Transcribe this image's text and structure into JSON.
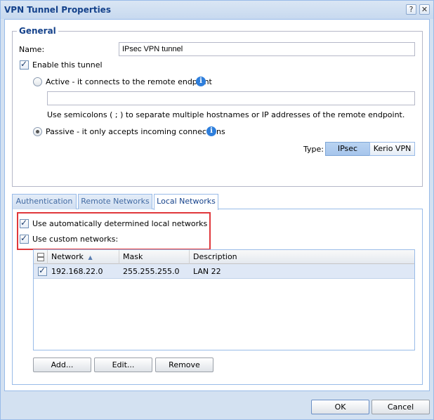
{
  "window": {
    "title": "VPN Tunnel Properties",
    "help_glyph": "?",
    "close_glyph": "✕"
  },
  "general": {
    "legend": "General",
    "name_label": "Name:",
    "name_value": "IPsec VPN tunnel",
    "enable_label": "Enable this tunnel",
    "enable_checked": true,
    "active_label": "Active - it connects to the remote endpoint",
    "active_selected": false,
    "endpoint_value": "",
    "endpoint_hint": "Use semicolons ( ; ) to separate multiple hostnames or IP addresses of the remote endpoint.",
    "passive_label": "Passive - it only accepts incoming connections",
    "passive_selected": true,
    "info_glyph": "i",
    "type_label": "Type:",
    "type_options": [
      "IPsec",
      "Kerio VPN"
    ],
    "type_selected": "IPsec"
  },
  "tabs": [
    {
      "label": "Authentication",
      "active": false
    },
    {
      "label": "Remote Networks",
      "active": false
    },
    {
      "label": "Local Networks",
      "active": true
    }
  ],
  "local_networks": {
    "auto_label": "Use automatically determined local networks",
    "auto_checked": true,
    "custom_label": "Use custom networks:",
    "custom_checked": true,
    "columns": [
      "Network",
      "Mask",
      "Description"
    ],
    "sort_glyph": "▲",
    "rows": [
      {
        "checked": true,
        "network": "192.168.22.0",
        "mask": "255.255.255.0",
        "description": "LAN 22"
      }
    ],
    "buttons": {
      "add": "Add...",
      "edit": "Edit...",
      "remove": "Remove"
    }
  },
  "footer": {
    "ok": "OK",
    "cancel": "Cancel"
  },
  "colors": {
    "highlight": "#e0373b",
    "title": "#15428b"
  }
}
